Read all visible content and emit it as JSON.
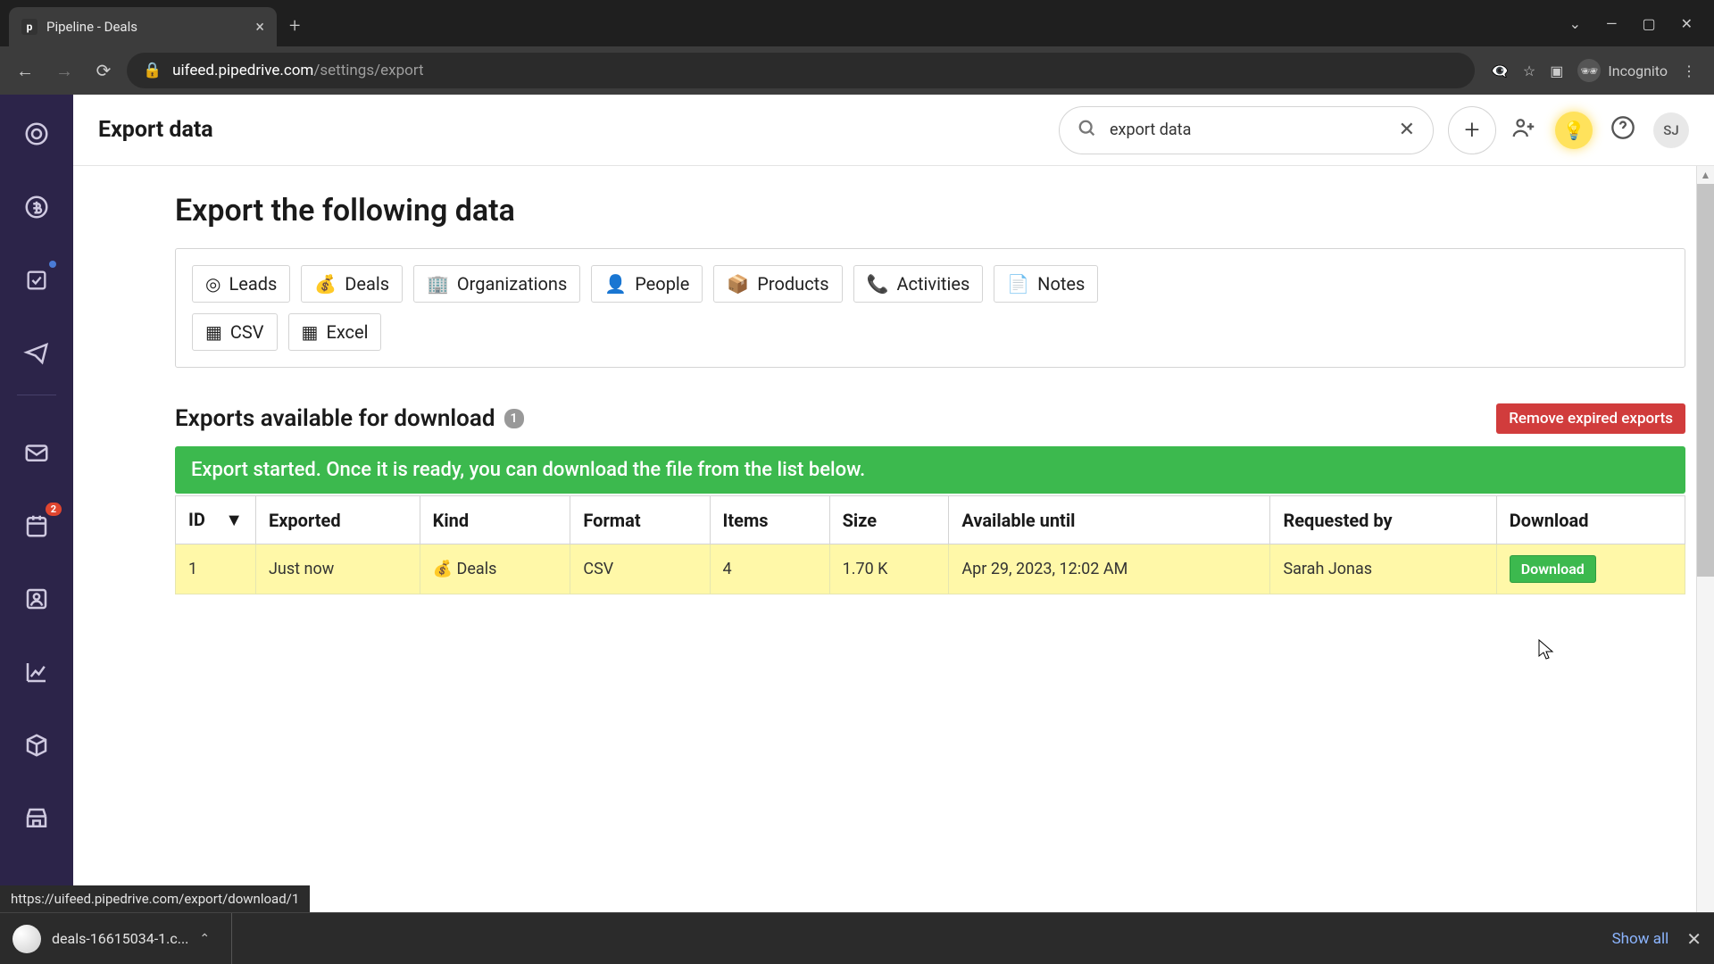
{
  "browser": {
    "tab_title": "Pipeline - Deals",
    "url_domain": "uifeed.pipedrive.com",
    "url_path": "/settings/export",
    "incognito_label": "Incognito"
  },
  "header": {
    "title": "Export data",
    "search_value": "export data",
    "avatar_initials": "SJ"
  },
  "main": {
    "heading": "Export the following data",
    "types": {
      "leads": "Leads",
      "deals": "Deals",
      "organizations": "Organizations",
      "people": "People",
      "products": "Products",
      "activities": "Activities",
      "notes": "Notes"
    },
    "formats": {
      "csv": "CSV",
      "excel": "Excel"
    },
    "downloads_heading": "Exports available for download",
    "downloads_count": "1",
    "remove_expired": "Remove expired exports",
    "status_message": "Export started. Once it is ready, you can download the file from the list below.",
    "columns": {
      "id": "ID",
      "exported": "Exported",
      "kind": "Kind",
      "format": "Format",
      "items": "Items",
      "size": "Size",
      "until": "Available until",
      "by": "Requested by",
      "dl": "Download"
    },
    "row": {
      "id": "1",
      "exported": "Just now",
      "kind": "Deals",
      "format": "CSV",
      "items": "4",
      "size": "1.70 K",
      "until": "Apr 29, 2023, 12:02 AM",
      "by": "Sarah Jonas",
      "dl_label": "Download"
    }
  },
  "status_link": "https://uifeed.pipedrive.com/export/download/1",
  "shelf": {
    "file": "deals-16615034-1.c...",
    "show_all": "Show all"
  }
}
